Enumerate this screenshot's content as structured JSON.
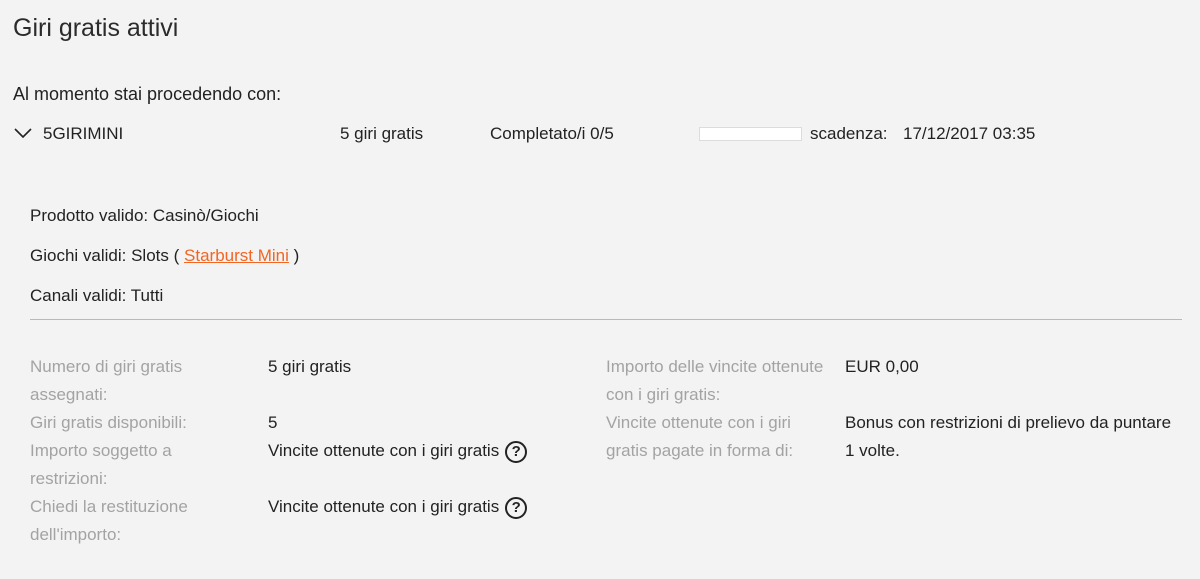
{
  "page": {
    "title": "Giri gratis attivi",
    "subtitle": "Al momento stai procedendo con:"
  },
  "bonus": {
    "code": "5GIRIMINI",
    "spins": "5 giri gratis",
    "completed": "Completato/i 0/5",
    "progress_fraction": 0,
    "expiry_label": "scadenza:",
    "expiry_value": "17/12/2017 03:35"
  },
  "details": {
    "product": "Prodotto valido: Casinò/Giochi",
    "games_prefix": "Giochi validi: Slots (",
    "game_link": "Starburst Mini",
    "games_suffix": ")",
    "channels": "Canali validi: Tutti"
  },
  "info_left": [
    {
      "label": "Numero di giri gratis assegnati:",
      "value": "5 giri gratis",
      "help": false
    },
    {
      "label": "Giri gratis disponibili:",
      "value": "5",
      "help": false
    },
    {
      "label": "Importo soggetto a restrizioni:",
      "value": "Vincite ottenute con i giri gratis",
      "help": true
    },
    {
      "label": "Chiedi la restituzione dell'importo:",
      "value": "Vincite ottenute con i giri gratis",
      "help": true
    }
  ],
  "info_right": [
    {
      "label": "Importo delle vincite ottenute con i giri gratis:",
      "value": "EUR 0,00"
    },
    {
      "label": "Vincite ottenute con i giri gratis pagate in forma di:",
      "value": "Bonus con restrizioni di prelievo da puntare 1 volte."
    }
  ],
  "help_glyph": "?",
  "colors": {
    "accent": "#f26522",
    "label": "#a3a3a3",
    "background": "#f3f3f3"
  }
}
